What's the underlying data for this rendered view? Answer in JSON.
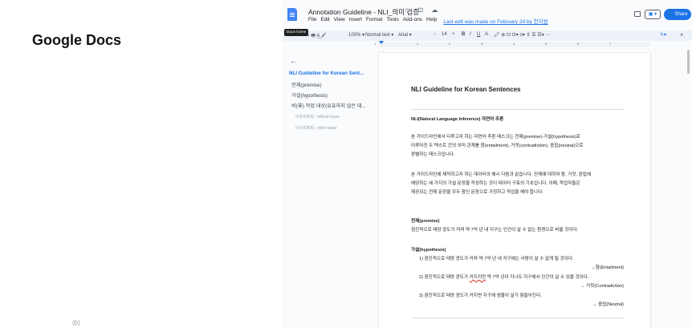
{
  "left_panel": {
    "title": "Google Docs",
    "footer": "(b)"
  },
  "header": {
    "doc_title": "Annotation Guideline - NLI_의미 검증",
    "title_icons": "☆ ⊡ ☁",
    "menu": [
      "File",
      "Edit",
      "View",
      "Insert",
      "Format",
      "Tools",
      "Add-ons",
      "Help"
    ],
    "last_edit": "Last edit was made on February 24 by 한지원",
    "present_label": "▣ ▾",
    "share_label": "👤 Share"
  },
  "tooltip": "Docs home",
  "toolbar": {
    "icons": "↶ ↷ 🖶 A͟ 🖌",
    "zoom": "100% ▾",
    "style": "Normal text ▾",
    "font": "Arial ▾",
    "size": "14",
    "minus": "−",
    "plus": "+",
    "bold": "B",
    "italic": "I",
    "underline": "U",
    "color": "A",
    "more_icons": "🖍 ⊕ ⊡ ⊡▾ ≡▾ ⇕ ☰ ☰▾ ⋯",
    "pencil": "✎▾",
    "collapse": "∧"
  },
  "ruler": {
    "numbers": [
      "1",
      "1",
      "2",
      "3",
      "4",
      "5",
      "6",
      "7"
    ]
  },
  "outline": {
    "back": "←",
    "items": [
      {
        "label": "NLI Guideline for Korean Sent...",
        "level": "h1"
      },
      {
        "label": "전제(premise)",
        "level": "h2"
      },
      {
        "label": "가설(hypothesis)",
        "level": "h2"
      },
      {
        "label": "비(非) 작업 대상(유효하지 않은 데...",
        "level": "h2"
      },
      {
        "label": "이슈리포팅 : ethical issue",
        "level": "h3"
      },
      {
        "label": "이슈리포팅 : other issue",
        "level": "h3"
      }
    ]
  },
  "document": {
    "heading": "NLI Guideline for Korean Sentences",
    "section_title": "NLI(Natural Language Inference) 자연어 추론",
    "para1": [
      "본 가이드라인에서 다루고자 하는 자연어 추론 태스크는 전제(premise)-가설(hypothesis)로",
      "이루어진 두 텍스트 간의 의미 관계를 참(entailment), 거짓(contradiction), 중립(neutral)으로",
      "판별하는 태스크입니다."
    ],
    "para2": [
      "본 가이드라인에 제작하고자 하는 데이터의 예시 다음과 같습니다. 전제에 대하여 참, 거짓, 중립에",
      "해당하는 세 가지의 가설 문장을 작성하는 것이 데이터 구축의 기초입니다. 이때, 작업자들은",
      "제공되는 전제 문장을 모두 참인 문장으로 가정하고 작업을 해야 합니다."
    ],
    "premise_label": "전제(premise)",
    "premise_text": "점진적으로 태양 광도가 커져 약 7억 년 내 지구는 인간이 살 수 없는 환경으로 바뀔 것이다.",
    "hypothesis_label": "가설(hypothesis)",
    "h1_text": "1)  점진적으로 태양 광도가 커져 약 7억 년 내 지구에는 사람이 살 수 없게 될 것이다.",
    "h1_label": "→참(Entailment)",
    "h2_pre": "2)  점진적으로 태양 광도가 ",
    "h2_squiggle": "커지지만",
    "h2_post": " 약 7억 년이 지나도 지구에서 인간이 살 수 있을 것이다.",
    "h2_label": "→ 거짓(Contradiction)",
    "h3_text": "3)  점진적으로 태양 광도가 커지면 지구에 생물이 살기 힘들어진다.",
    "h3_label": "→ 중립(Neutral)"
  }
}
